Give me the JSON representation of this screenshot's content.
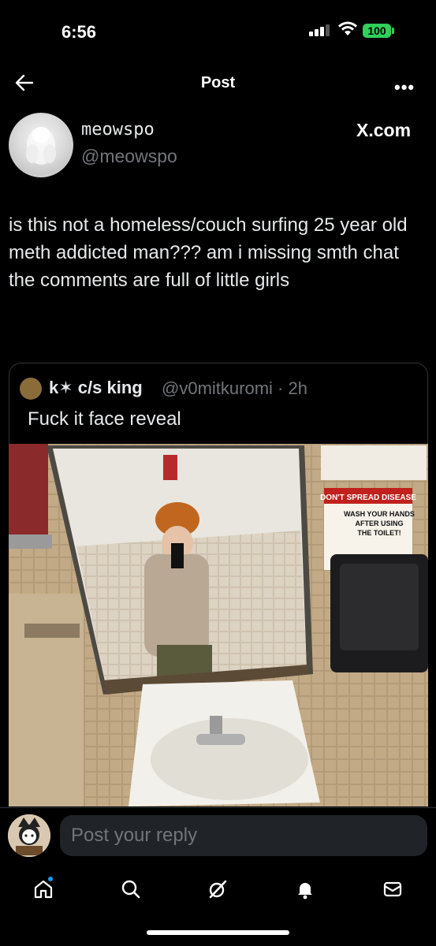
{
  "status_bar": {
    "time": "6:56",
    "battery": "100"
  },
  "header": {
    "title": "Post",
    "more": "•••"
  },
  "author": {
    "name": "meowspo",
    "handle": "@meowspo",
    "source": "X.com"
  },
  "post": {
    "text": "is this not a homeless/couch surfing 25 year old meth addicted man??? am i missing smth chat the comments are full of little girls"
  },
  "quote": {
    "name": "k✶ c/s king",
    "handle": "@v0mitkuromi · 2h",
    "text": "Fuck it face reveal",
    "sign": {
      "title": "DON'T SPREAD DISEASE",
      "line1": "WASH YOUR HANDS",
      "line2": "AFTER USING",
      "line3": "THE TOILET!"
    }
  },
  "reply": {
    "placeholder": "Post your reply"
  },
  "nav": {
    "items": [
      "home",
      "search",
      "grok",
      "notifications",
      "messages"
    ]
  },
  "colors": {
    "accent": "#1d9bf0",
    "battery": "#30d158",
    "muted": "#71767b"
  }
}
